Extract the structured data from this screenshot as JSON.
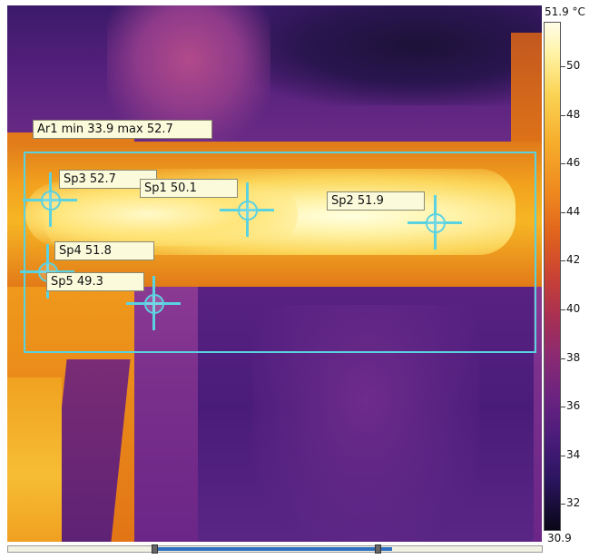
{
  "image": {
    "area": {
      "label": "Ar1 min 33.9 max 52.7"
    },
    "spots": [
      {
        "id": "sp3",
        "label": "Sp3 52.7"
      },
      {
        "id": "sp1",
        "label": "Sp1 50.1"
      },
      {
        "id": "sp2",
        "label": "Sp2 51.9"
      },
      {
        "id": "sp4",
        "label": "Sp4 51.8"
      },
      {
        "id": "sp5",
        "label": "Sp5 49.3"
      }
    ]
  },
  "scale": {
    "max_label": "51.9 °C",
    "min_label": "30.9",
    "ticks": [
      "50",
      "48",
      "46",
      "44",
      "42",
      "40",
      "38",
      "36",
      "34",
      "32"
    ]
  },
  "slider": {
    "range_fraction": [
      0.27,
      0.7
    ]
  },
  "colors": {
    "marker": "#5ad2e0",
    "label_bg": "#fbfbdc"
  }
}
